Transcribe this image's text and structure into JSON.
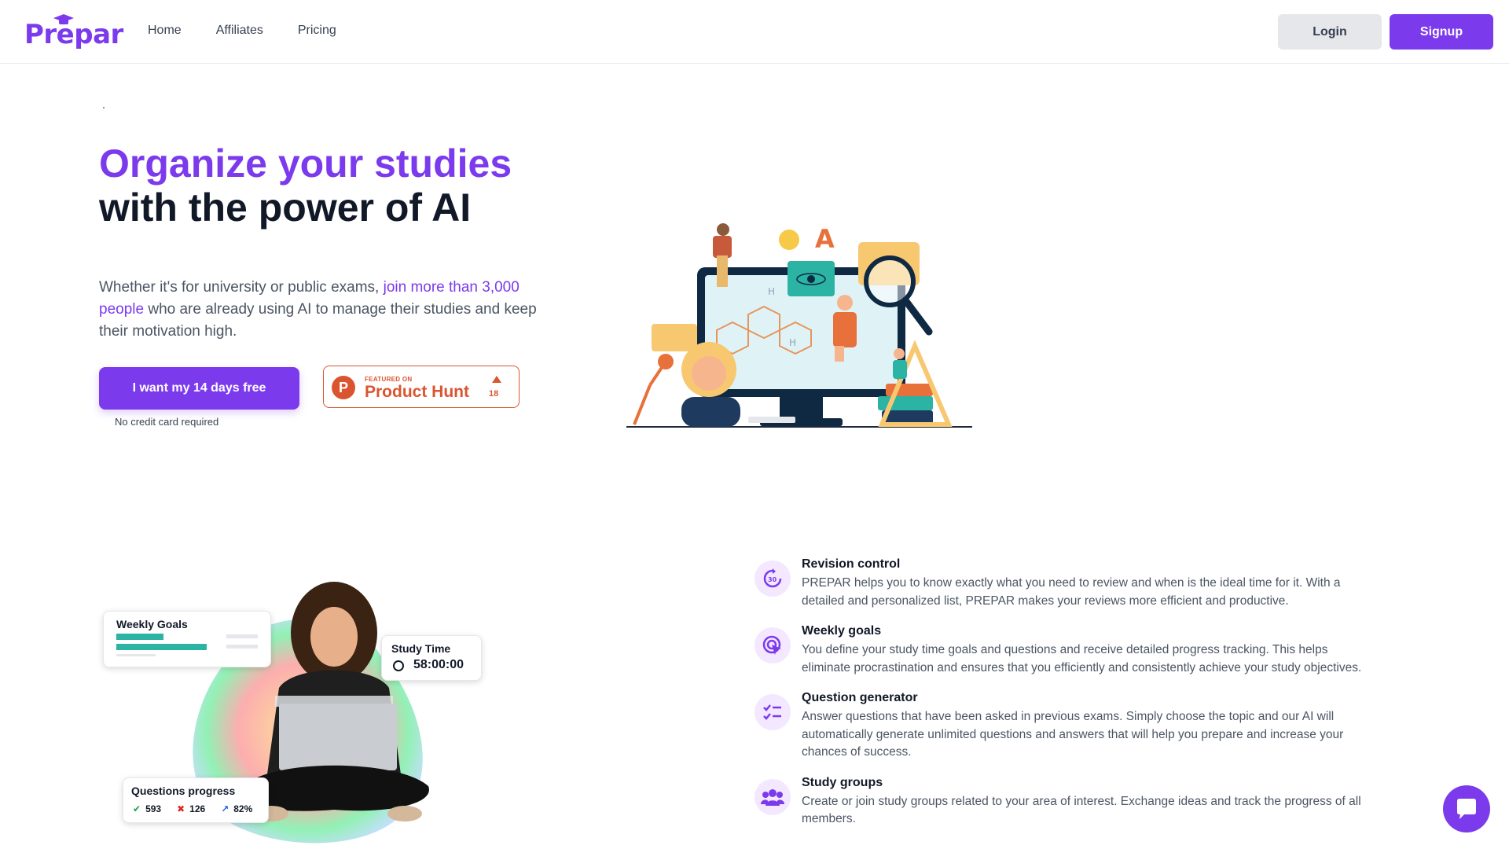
{
  "header": {
    "logo_text": "Prepar",
    "nav": [
      "Home",
      "Affiliates",
      "Pricing"
    ],
    "login_label": "Login",
    "signup_label": "Signup"
  },
  "hero": {
    "title_line1": "Organize your studies",
    "title_line2": "with the power of AI",
    "subtitle_pre": "Whether it's for university or public exams, ",
    "subtitle_highlight": "join more than 3,000 people",
    "subtitle_post": " who are already using AI to manage their studies and keep their motivation high.",
    "cta_label": "I want my 14 days free",
    "cta_note": "No credit card required",
    "product_hunt": {
      "featured": "FEATURED ON",
      "name": "Product Hunt",
      "count": "18"
    }
  },
  "widgets": {
    "weekly_goals_title": "Weekly Goals",
    "study_time_title": "Study Time",
    "study_time_value": "58:00:00",
    "questions_progress_title": "Questions progress",
    "questions_correct": "593",
    "questions_wrong": "126",
    "questions_percent": "82%"
  },
  "features": [
    {
      "icon": "revision-30-icon",
      "title": "Revision control",
      "desc": "PREPAR helps you to know exactly what you need to review and when is the ideal time for it. With a detailed and personalized list, PREPAR makes your reviews more efficient and productive."
    },
    {
      "icon": "target-cursor-icon",
      "title": "Weekly goals",
      "desc": "You define your study time goals and questions and receive detailed progress tracking. This helps eliminate procrastination and ensures that you efficiently and consistently achieve your study objectives."
    },
    {
      "icon": "checklist-icon",
      "title": "Question generator",
      "desc": "Answer questions that have been asked in previous exams. Simply choose the topic and our AI will automatically generate unlimited questions and answers that will help you prepare and increase your chances of success."
    },
    {
      "icon": "group-icon",
      "title": "Study groups",
      "desc": "Create or join study groups related to your area of interest. Exchange ideas and track the progress of all members."
    }
  ],
  "colors": {
    "brand": "#7c3aed",
    "product_hunt": "#da552f"
  }
}
